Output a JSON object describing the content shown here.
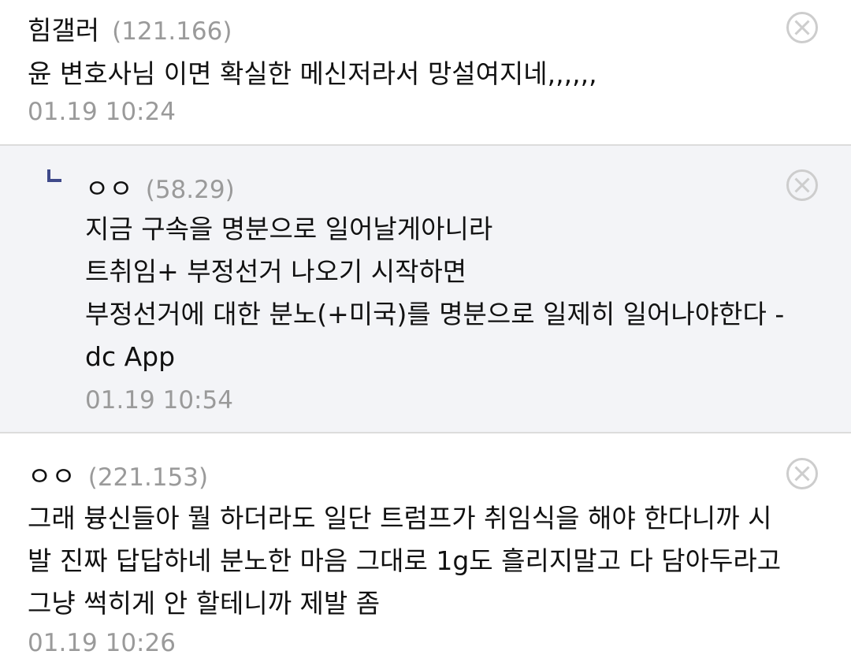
{
  "comments": [
    {
      "nick": "힘갤러",
      "ip": "(121.166)",
      "lines": [
        "윤 변호사님 이면 확실한 메신저라서 망설여지네,,,,,,"
      ],
      "date": "01.19 10:24",
      "is_reply": false
    },
    {
      "nick": "ㅇㅇ",
      "ip": "(58.29)",
      "lines": [
        "지금 구속을 명분으로 일어날게아니라",
        "트취임+ 부정선거 나오기 시작하면",
        "부정선거에 대한 분노(+미국)를 명분으로 일제히 일어나야한다 -",
        "dc App"
      ],
      "date": "01.19 10:54",
      "is_reply": true
    },
    {
      "nick": "ㅇㅇ",
      "ip": "(221.153)",
      "lines": [
        "그래 븅신들아 뭘 하더라도 일단 트럼프가 취임식을 해야 한다니까 시",
        "발 진짜 답답하네 분노한 마음 그대로 1g도 흘리지말고 다 담아두라고",
        "그냥 썩히게 안 할테니까 제발 좀"
      ],
      "date": "01.19 10:26",
      "is_reply": false
    }
  ],
  "icons": {
    "delete": "close-circle-icon",
    "reply": "reply-arrow-icon"
  },
  "colors": {
    "reply_bg": "#f3f4f7",
    "meta_gray": "#9a9a9a",
    "divider": "#dcdcdc",
    "reply_icon": "#3f4a8a"
  }
}
